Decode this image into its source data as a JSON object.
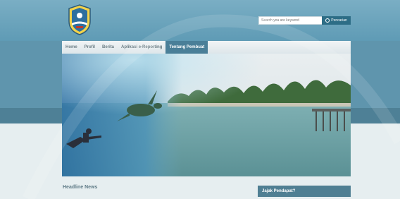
{
  "header": {
    "logo_name": "crest-logo",
    "search": {
      "placeholder": "Search you are keyword",
      "button_label": "Pencarian",
      "button_icon": "search-icon"
    }
  },
  "nav": {
    "items": [
      {
        "label": "Home",
        "active": false
      },
      {
        "label": "Profil",
        "active": false
      },
      {
        "label": "Berita",
        "active": false
      },
      {
        "label": "Aplikasi e-Reporting",
        "active": false
      },
      {
        "label": "Tentang Pembuat",
        "active": true
      }
    ]
  },
  "main": {
    "headline_title": "Headline News"
  },
  "sidebar": {
    "poll_title": "Jajak Pendapat?"
  },
  "colors": {
    "nav_active": "#4a7f98",
    "search_button": "#2d6d86",
    "poll_header": "#4f7f93"
  }
}
